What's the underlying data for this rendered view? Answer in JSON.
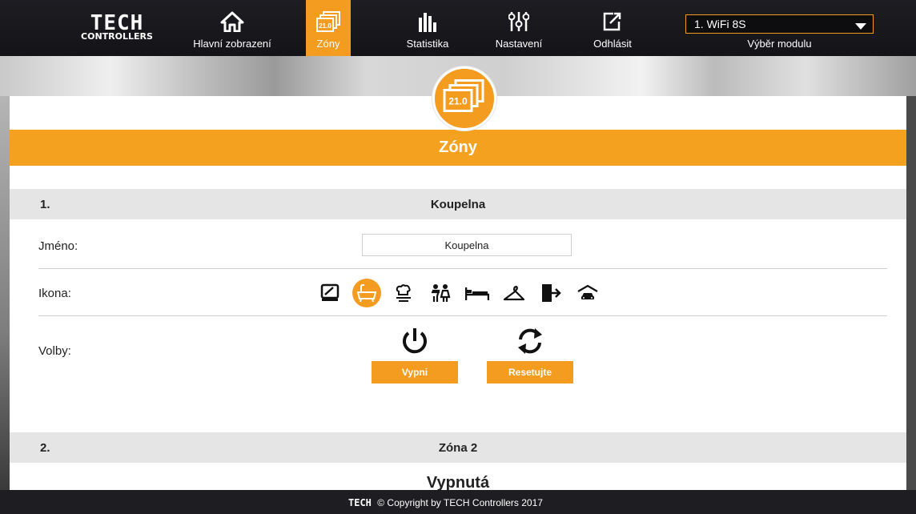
{
  "header": {
    "logo_text": "TECH",
    "logo_sub": "CONTROLLERS",
    "nav": [
      {
        "label": "Hlavní zobrazení",
        "icon": "home-icon"
      },
      {
        "label": "Zóny",
        "icon": "zones-icon",
        "badge": "21.0",
        "active": true
      },
      {
        "label": "Statistika",
        "icon": "statistics-icon"
      },
      {
        "label": "Nastavení",
        "icon": "settings-sliders-icon"
      },
      {
        "label": "Odhlásit",
        "icon": "logout-icon"
      }
    ],
    "module_select": {
      "value": "1. WiFi 8S",
      "label": "Výběr modulu"
    }
  },
  "badge": {
    "value": "21.0"
  },
  "section": {
    "title": "Zóny"
  },
  "zones": [
    {
      "number": "1.",
      "name": "Koupelna",
      "name_label": "Jméno:",
      "name_value": "Koupelna",
      "icon_label": "Ikona:",
      "icons": [
        "tv-icon",
        "bathtub-icon",
        "kitchen-icon",
        "children-icon",
        "bed-icon",
        "hanger-icon",
        "exit-door-icon",
        "garage-icon"
      ],
      "selected_icon": "bathtub-icon",
      "options_label": "Volby:",
      "buttons": {
        "off": "Vypni",
        "reset": "Resetujte"
      }
    },
    {
      "number": "2.",
      "name": "Zóna 2",
      "state": "Vypnutá"
    }
  ],
  "footer": {
    "logo": "TECH",
    "text": "© Copyright by TECH Controllers 2017"
  },
  "colors": {
    "accent": "#f39c1f",
    "topbar": "#17171b",
    "zone_header": "#e5e5e5"
  }
}
